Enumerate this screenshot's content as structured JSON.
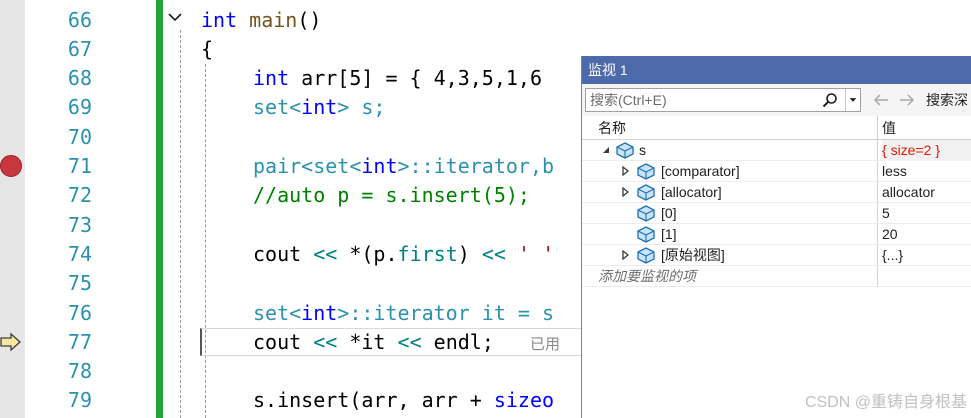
{
  "editor": {
    "line_numbers": [
      "66",
      "67",
      "68",
      "69",
      "70",
      "71",
      "72",
      "73",
      "74",
      "75",
      "76",
      "77",
      "78",
      "79"
    ],
    "code": {
      "l66": {
        "kw": "int",
        "fn": "main",
        "rest": "()"
      },
      "l67": "{",
      "l68": {
        "kw": "int",
        "rest": " arr[5] = { 4,3,5,1,6"
      },
      "l69": {
        "a": "set<",
        "kw": "int",
        "b": "> s;"
      },
      "l71": {
        "a": "pair<set<",
        "kw": "int",
        "b": ">::iterator,b"
      },
      "l72": "//auto p = s.insert(5);",
      "l74": {
        "a": "cout ",
        "op1": "<<",
        "b": " *(p.",
        "c": "first",
        "d": ") ",
        "op2": "<<",
        "e": " ",
        "st": "' '"
      },
      "l76": {
        "a": "set<",
        "kw": "int",
        "b": ">::iterator it = s"
      },
      "l77": {
        "a": "cout ",
        "op1": "<<",
        "b": " *it ",
        "op2": "<<",
        "c": " endl;",
        "hint": "已用"
      },
      "l79": {
        "a": "s.insert(arr, arr + ",
        "kw": "sizeo"
      }
    }
  },
  "watch": {
    "title": "监视 1",
    "search_placeholder": "搜索(Ctrl+E)",
    "search_depth_label": "搜索深",
    "col_name": "名称",
    "col_value": "值",
    "rows": [
      {
        "name": "s",
        "value": "{ size=2 }"
      },
      {
        "name": "[comparator]",
        "value": "less"
      },
      {
        "name": "[allocator]",
        "value": "allocator"
      },
      {
        "name": "[0]",
        "value": "5"
      },
      {
        "name": "[1]",
        "value": "20"
      },
      {
        "name": "[原始视图]",
        "value": "{...}"
      }
    ],
    "add_item_placeholder": "添加要监视的项"
  },
  "watermark": "CSDN @重铸自身根基",
  "colors": {
    "keyword": "#0000ff",
    "type": "#2b91af",
    "comment": "#008000",
    "string": "#a31515",
    "change_bar": "#22a33b",
    "watch_title": "#4d6aaa",
    "changed_value": "#e51400",
    "breakpoint": "#c8373f"
  },
  "icons": [
    "fold-chevron-icon",
    "breakpoint-icon",
    "execution-arrow-icon",
    "search-icon",
    "dropdown-icon",
    "back-arrow-icon",
    "forward-arrow-icon",
    "expand-triangle-icon",
    "object-icon"
  ]
}
